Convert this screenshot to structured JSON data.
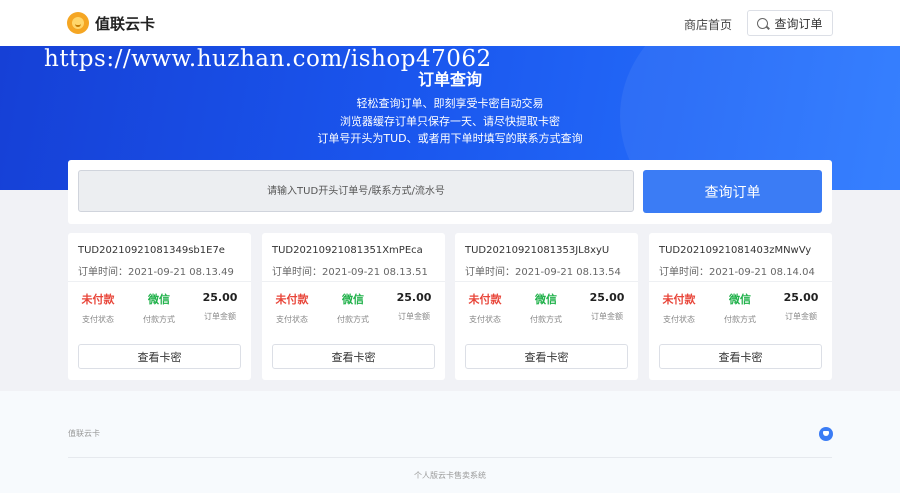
{
  "header": {
    "brand": "值联云卡",
    "nav_home": "商店首页",
    "nav_query": "查询订单"
  },
  "banner": {
    "watermark": "https://www.huzhan.com/ishop47062",
    "title": "订单查询",
    "lines": [
      "轻松查询订单、即刻享受卡密自动交易",
      "浏览器缓存订单只保存一天、请尽快提取卡密",
      "订单号开头为TUD、或者用下单时填写的联系方式查询"
    ]
  },
  "search": {
    "placeholder": "请输入TUD开头订单号/联系方式/流水号",
    "button": "查询订单"
  },
  "labels": {
    "time_prefix": "订单时间：",
    "status_label": "支付状态",
    "method_label": "付款方式",
    "amount_label": "订单金额",
    "view_button": "查看卡密"
  },
  "orders": [
    {
      "id": "TUD20210921081349sb1E7e",
      "time": "2021-09-21 08.13.49",
      "status": "未付款",
      "method": "微信",
      "amount": "25.00"
    },
    {
      "id": "TUD20210921081351XmPEca",
      "time": "2021-09-21 08.13.51",
      "status": "未付款",
      "method": "微信",
      "amount": "25.00"
    },
    {
      "id": "TUD20210921081353JL8xyU",
      "time": "2021-09-21 08.13.54",
      "status": "未付款",
      "method": "微信",
      "amount": "25.00"
    },
    {
      "id": "TUD20210921081403zMNwVy",
      "time": "2021-09-21 08.14.04",
      "status": "未付款",
      "method": "微信",
      "amount": "25.00"
    }
  ],
  "footer": {
    "brand": "值联云卡",
    "copyright": "个人版云卡售卖系统"
  },
  "colors": {
    "accent": "#3b7cf5",
    "status_unpaid": "#e8463a",
    "method_wechat": "#20b14a",
    "banner": "#1a56ee"
  }
}
